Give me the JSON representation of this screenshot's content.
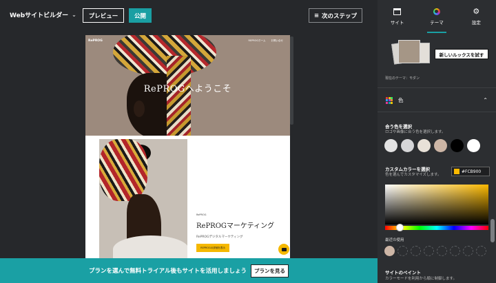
{
  "topbar": {
    "site_builder": "Webサイトビルダー",
    "preview_label": "プレビュー",
    "publish_label": "公開",
    "next_step_label": "次のステップ"
  },
  "preview": {
    "logo": "RePROG",
    "nav": [
      "REPROGホーム",
      "お問い合せ"
    ],
    "hero_title": "RePROGへようこそ",
    "kicker": "RePROG",
    "subheading": "RePROGマーケティング",
    "description": "RePROGデジタルマーケティング",
    "cta_label": "REPROGの詳細を表示"
  },
  "banner": {
    "message": "プランを選んで無料トライアル後もサイトを活用しましょう",
    "button_label": "プランを見る"
  },
  "panel": {
    "tabs": [
      {
        "label": "サイト",
        "icon": "site-icon",
        "active": false
      },
      {
        "label": "テーマ",
        "icon": "theme-icon",
        "active": true
      },
      {
        "label": "設定",
        "icon": "gear-icon",
        "active": false
      }
    ],
    "try_look_label": "新しいルックスを試す",
    "current_theme": "現在のテーマ：モダン",
    "color_section_label": "色",
    "match_title": "合う色を選択",
    "match_sub": "ロゴや画像に合う色を選択します。",
    "swatches": [
      "#e3e3e3",
      "#d6d6d8",
      "#e8e1d8",
      "#cdb6a6",
      "#000000",
      "#ffffff"
    ],
    "custom_title": "カスタムカラーを選択",
    "custom_sub": "色を選んでカスタマイズします。",
    "custom_hex": "#FCB900",
    "recent_title": "最近の使用",
    "recent_colors": [
      "#cdb6a6"
    ],
    "paint_title": "サイトのペイント",
    "paint_sub": "カラーモードを利用から順に制御します。"
  },
  "colors": {
    "accent": "#1aa0a4",
    "yellow": "#fcb900",
    "panel_bg": "#2c2e31",
    "app_bg": "#26282b"
  }
}
